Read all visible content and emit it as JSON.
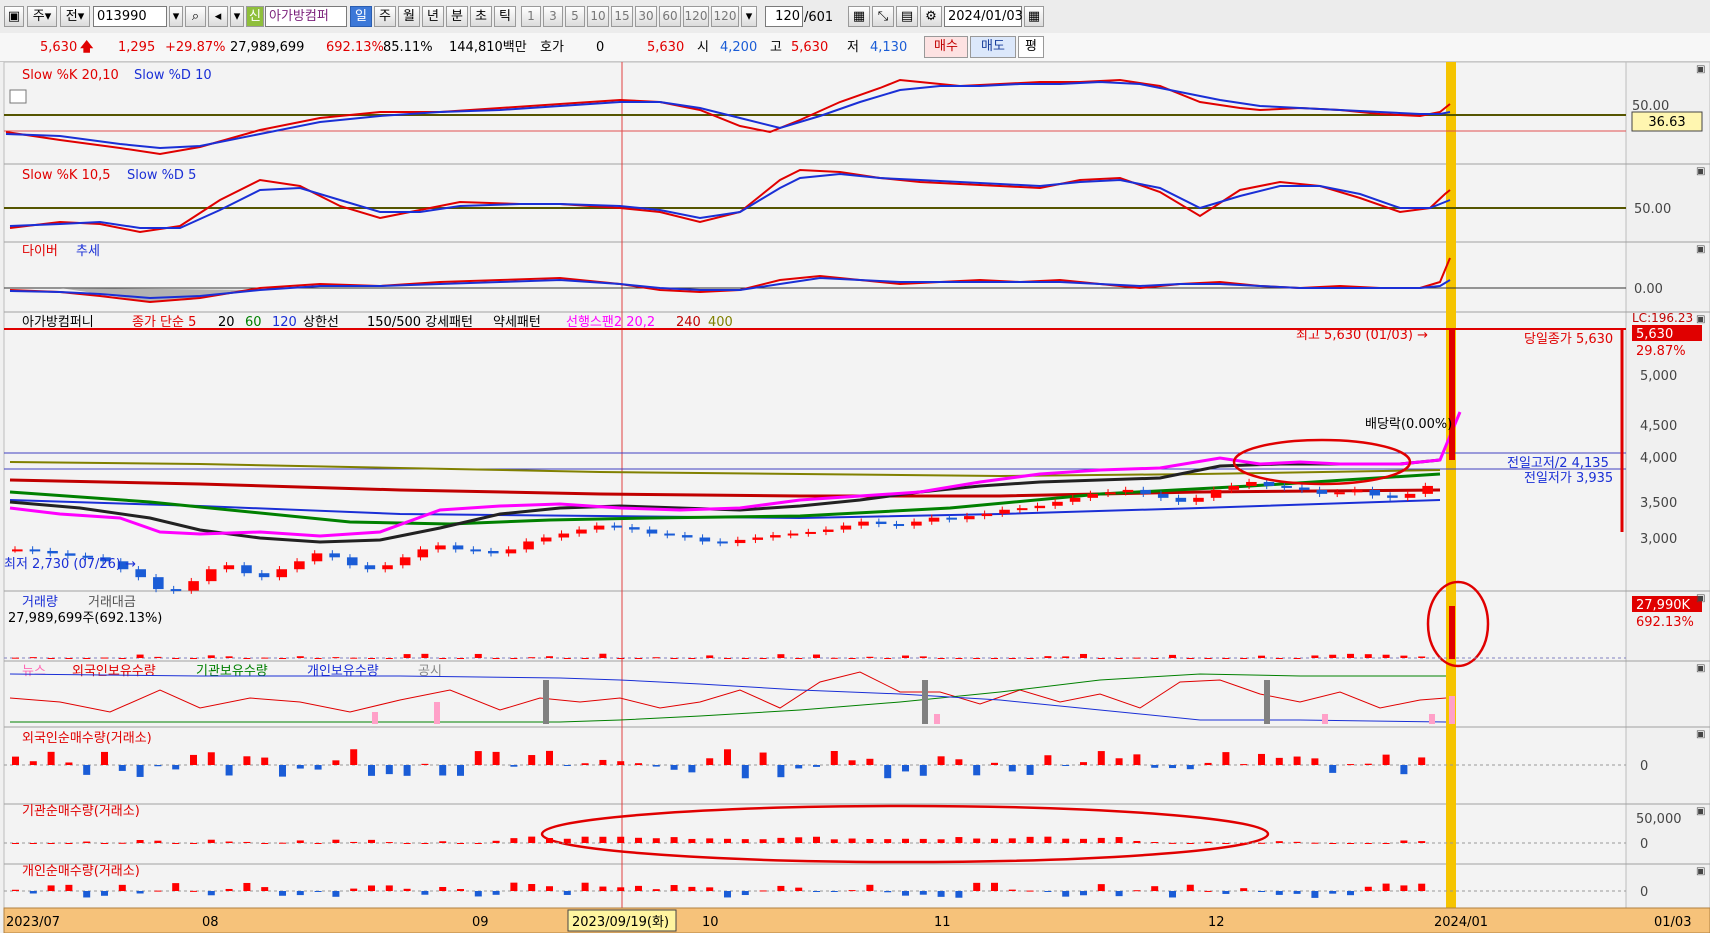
{
  "toolbar": {
    "period_label": "주",
    "prev_label": "전",
    "code": "013990",
    "new_badge": "신",
    "stock_name": "아가방컴퍼",
    "intervals": [
      "일",
      "주",
      "월",
      "년",
      "분",
      "초",
      "틱"
    ],
    "selected_interval": "일",
    "minute_options": [
      "1",
      "3",
      "5",
      "10",
      "15",
      "30",
      "60",
      "120",
      "120"
    ],
    "bar_count": "120",
    "bar_total": "/601",
    "date": "2024/01/03"
  },
  "info": {
    "price": "5,630",
    "change": "1,295",
    "change_pct": "+29.87%",
    "volume": "27,989,699",
    "volume_ratio": "692.13%",
    "turnover": "85.11%",
    "amount": "144,810백만",
    "quote_label": "호가",
    "quote_value": "0",
    "quote_price": "5,630",
    "open_label": "시",
    "open": "4,200",
    "high_label": "고",
    "high": "5,630",
    "low_label": "저",
    "low": "4,130",
    "buy_label": "매수",
    "sell_label": "매도",
    "flat_label": "평"
  },
  "panels": {
    "stoch1": {
      "k_label": "Slow %K 20,10",
      "d_label": "Slow %D 10",
      "tick": "50.00",
      "value_box": "36.63"
    },
    "stoch2": {
      "k_label": "Slow %K 10,5",
      "d_label": "Slow %D 5",
      "tick": "50.00"
    },
    "diver": {
      "label1": "다이버",
      "label2": "추세",
      "tick": "0.00"
    },
    "price": {
      "legend": [
        "아가방컴퍼니",
        "종가 단순 5",
        "20",
        "60",
        "120",
        "상한선",
        "150/500 강세패턴",
        "약세패턴",
        "선행스팬2 20,2",
        "240",
        "400"
      ],
      "high_note": "최고 5,630 (01/03) →",
      "low_note": "최저 2,730 (07/26) →",
      "close_note": "당일종가 5,630",
      "prev_high_note": "전일고저/2 4,135",
      "prev_low_note": "전일저가 3,935",
      "div_note": "배당락(0.00%)",
      "corner_note": "LC:196.23",
      "price_box": "5,630",
      "pct_label": "29.87%",
      "ticks": [
        "5,000",
        "4,500",
        "4,000",
        "3,500",
        "3,000"
      ]
    },
    "volume": {
      "label": "거래량",
      "label2": "거래대금",
      "value": "27,989,699주(692.13%)",
      "box": "27,990K",
      "pct": "692.13%"
    },
    "holdings": {
      "labels": [
        "뉴스",
        "외국인보유수량",
        "기관보유수량",
        "개인보유수량",
        "공시"
      ]
    },
    "foreign": {
      "label": "외국인순매수량(거래소)",
      "tick": "0"
    },
    "inst": {
      "label": "기관순매수량(거래소)",
      "ticks": [
        "50,000",
        "0"
      ]
    },
    "retail": {
      "label": "개인순매수량(거래소)",
      "tick": "0"
    }
  },
  "xaxis": {
    "labels": [
      "2023/07",
      "08",
      "09",
      "10",
      "11",
      "12",
      "2024/01"
    ],
    "selected_date": "2023/09/19(화)",
    "right_label": "01/03"
  },
  "colors": {
    "up": "#ff0000",
    "down": "#1a5cd6",
    "highlight": "#f5c400",
    "axis_bg": "#f6c27a"
  },
  "chart_data": {
    "type": "candlestick",
    "period": "daily",
    "x_range": [
      "2023/07",
      "2024/01/03"
    ],
    "y_range": [
      2730,
      5630
    ],
    "candles": [
      {
        "date": "2024/01/03",
        "open": 4200,
        "high": 5630,
        "low": 4130,
        "close": 5630
      }
    ],
    "close_approx": [
      3300,
      3280,
      3250,
      3220,
      3200,
      3150,
      3050,
      2950,
      2800,
      2780,
      2900,
      3050,
      3100,
      3000,
      2950,
      3050,
      3150,
      3250,
      3200,
      3100,
      3050,
      3100,
      3200,
      3300,
      3350,
      3300,
      3280,
      3250,
      3300,
      3400,
      3450,
      3500,
      3550,
      3600,
      3580,
      3550,
      3500,
      3480,
      3450,
      3400,
      3380,
      3420,
      3450,
      3480,
      3500,
      3520,
      3550,
      3600,
      3650,
      3620,
      3600,
      3650,
      3700,
      3680,
      3720,
      3750,
      3800,
      3820,
      3850,
      3900,
      3950,
      4000,
      4020,
      4050,
      4000,
      3950,
      3900,
      3950,
      4050,
      4100,
      4150,
      4100,
      4080,
      4050,
      4000,
      4020,
      4050,
      3980,
      3950,
      4000,
      4100,
      5630
    ],
    "ma20_approx": [
      3400,
      3380,
      3350,
      3300,
      3250,
      3200,
      3150,
      3120,
      3100,
      3150,
      3200,
      3250,
      3300,
      3320,
      3350,
      3380,
      3400,
      3420,
      3450,
      3480,
      3520,
      3560,
      3600,
      3650,
      3700,
      3750,
      3800,
      3850,
      3900,
      3950,
      3980,
      4000,
      4000,
      4000,
      4010,
      4020,
      4030,
      4200
    ],
    "ma60_approx": [
      3500,
      3450,
      3400,
      3300,
      3250,
      3200,
      3220,
      3250,
      3280,
      3300,
      3320,
      3330,
      3350,
      3380,
      3400,
      3420,
      3450,
      3500,
      3550,
      3600,
      3650,
      3700,
      3750,
      3800
    ],
    "ma120_approx": [
      3600,
      3550,
      3500,
      3450,
      3420,
      3400,
      3380,
      3360,
      3350,
      3360,
      3380,
      3400,
      3420,
      3450,
      3480,
      3500,
      3520,
      3550
    ],
    "prev_high_half": 4135,
    "prev_low": 3935,
    "volume_last": 27989699,
    "volume_ratio_pct": 692.13,
    "stoch1_value": 36.63
  }
}
